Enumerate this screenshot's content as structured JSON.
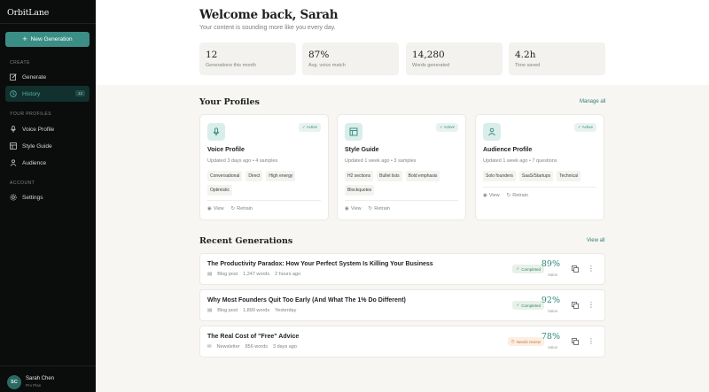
{
  "brand": {
    "name": "OrbitLane",
    "accent": "#3a8e86"
  },
  "sidebar": {
    "new_button": "New Generation",
    "sections": {
      "create": "CREATE",
      "your_profiles": "YOUR PROFILES",
      "account": "ACCOUNT"
    },
    "items": [
      {
        "label": "Generate",
        "icon": "edit-icon"
      },
      {
        "label": "History",
        "icon": "clock-icon",
        "badge": "12",
        "active": true
      },
      {
        "label": "Voice Profile",
        "icon": "mic-icon"
      },
      {
        "label": "Style Guide",
        "icon": "layout-icon"
      },
      {
        "label": "Audience",
        "icon": "people-icon"
      },
      {
        "label": "Settings",
        "icon": "gear-icon"
      }
    ],
    "user": {
      "initials": "SC",
      "name": "Sarah Chen",
      "plan": "Pro Plan"
    }
  },
  "header": {
    "title": "Welcome back, Sarah",
    "subtitle": "Your content is sounding more like you every day."
  },
  "stats": [
    {
      "value": "12",
      "label": "Generations this month"
    },
    {
      "value": "87%",
      "label": "Avg. voice match"
    },
    {
      "value": "14,280",
      "label": "Words generated"
    },
    {
      "value": "4.2h",
      "label": "Time saved"
    }
  ],
  "profiles": {
    "heading": "Your Profiles",
    "manage_link": "Manage all",
    "cards": [
      {
        "icon": "mic-icon",
        "status": "Active",
        "title": "Voice Profile",
        "meta": "Updated 3 days ago • 4 samples",
        "tags": [
          "Conversational",
          "Direct",
          "High energy",
          "Optimistic"
        ],
        "view": "View",
        "retrain": "Retrain"
      },
      {
        "icon": "layout-icon",
        "status": "Active",
        "title": "Style Guide",
        "meta": "Updated 1 week ago • 3 samples",
        "tags": [
          "H2 sections",
          "Bullet lists",
          "Bold emphasis",
          "Blockquotes"
        ],
        "view": "View",
        "retrain": "Retrain"
      },
      {
        "icon": "people-icon",
        "status": "Active",
        "title": "Audience Profile",
        "meta": "Updated 1 week ago • 7 questions",
        "tags": [
          "Solo founders",
          "SaaS/Startups",
          "Technical"
        ],
        "view": "View",
        "retrain": "Retrain"
      }
    ]
  },
  "recent": {
    "heading": "Recent Generations",
    "view_all": "View all",
    "voice_label": "Voice",
    "items": [
      {
        "title": "The Productivity Paradox: How Your Perfect System Is Killing Your Business",
        "type": "Blog post",
        "words": "1,247 words",
        "time": "2 hours ago",
        "status": "Completed",
        "score": "89%"
      },
      {
        "title": "Why Most Founders Quit Too Early (And What The 1% Do Different)",
        "type": "Blog post",
        "words": "1,890 words",
        "time": "Yesterday",
        "status": "Completed",
        "score": "92%"
      },
      {
        "title": "The Real Cost of \"Free\" Advice",
        "type": "Newsletter",
        "words": "856 words",
        "time": "3 days ago",
        "status": "Needs review",
        "score": "78%"
      }
    ]
  }
}
